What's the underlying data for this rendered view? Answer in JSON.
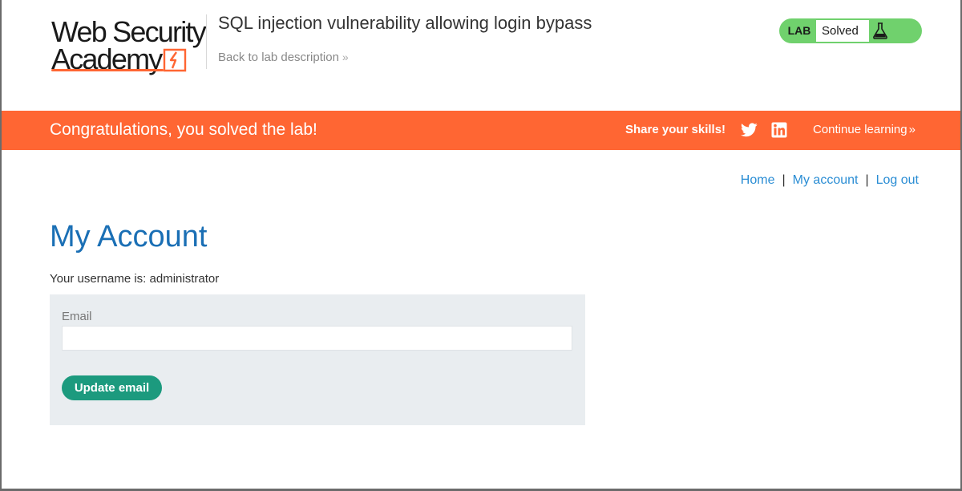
{
  "header": {
    "logo_line1": "Web Security",
    "logo_line2": "Academy",
    "lab_title": "SQL injection vulnerability allowing login bypass",
    "back_link": "Back to lab description",
    "back_chevron": "»",
    "lab_badge": "LAB",
    "lab_status": "Solved",
    "icons": [
      "lightning-bolt-icon",
      "flask-icon"
    ]
  },
  "banner": {
    "message": "Congratulations, you solved the lab!",
    "share_label": "Share your skills!",
    "continue_label": "Continue learning",
    "continue_chevron": "»",
    "icons": [
      "twitter-icon",
      "linkedin-icon"
    ]
  },
  "nav": {
    "home": "Home",
    "my_account": "My account",
    "log_out": "Log out",
    "separator": "|"
  },
  "main": {
    "title": "My Account",
    "username_text": "Your username is: administrator",
    "email_label": "Email",
    "email_value": "",
    "email_placeholder": "",
    "update_button": "Update email"
  },
  "colors": {
    "brand_orange": "#ff6633",
    "lab_green": "#70d16d",
    "button_teal": "#1c9a7e",
    "link_blue": "#2a8dd4",
    "title_blue": "#1a6fb5",
    "form_bg": "#e9edf0"
  }
}
